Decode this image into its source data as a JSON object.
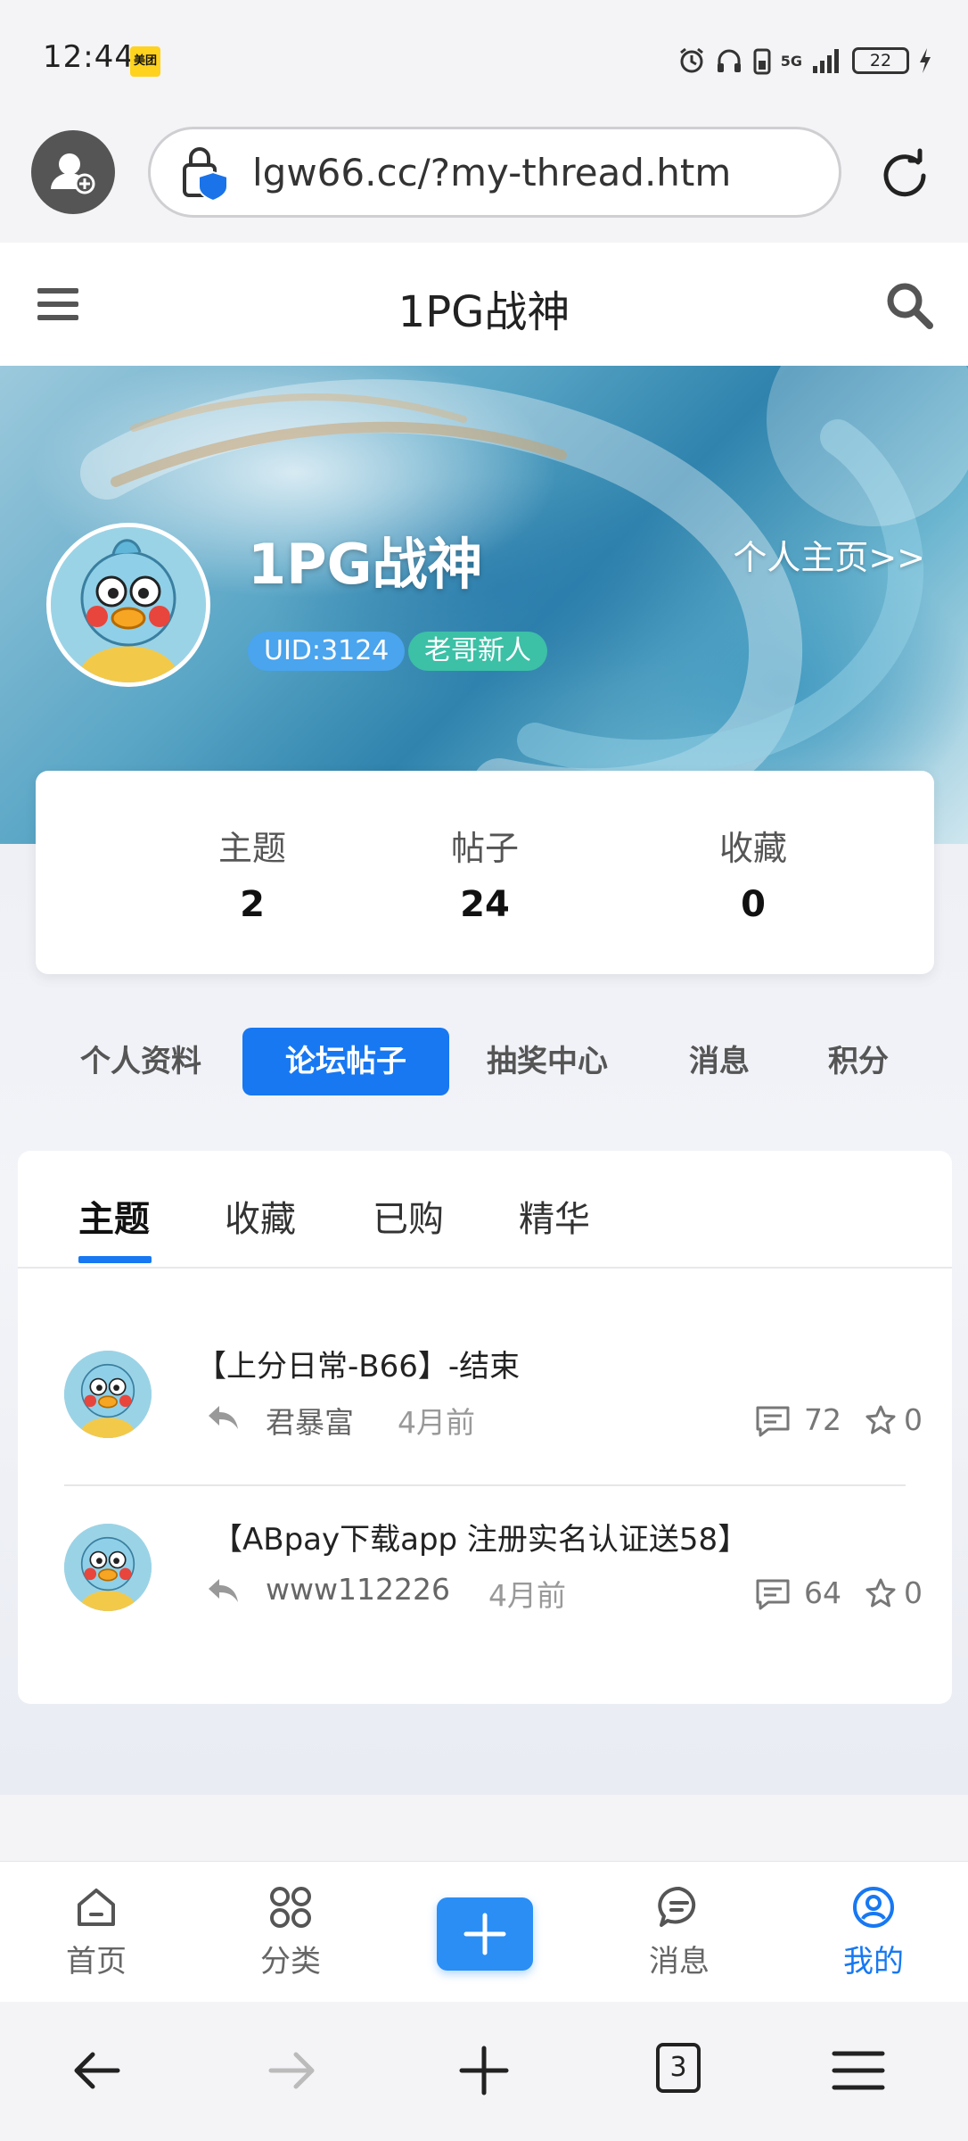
{
  "status_bar": {
    "time": "12:44",
    "app_badge": "美团",
    "network": "5G",
    "battery": "22"
  },
  "browser": {
    "url": "lgw66.cc/?my-thread.htm",
    "tab_count": "3"
  },
  "site": {
    "title": "1PG战神"
  },
  "profile": {
    "name": "1PG战神",
    "home_link": "个人主页>>",
    "uid": "UID:3124",
    "level": "老哥新人"
  },
  "stats": [
    {
      "label": "主题",
      "value": "2"
    },
    {
      "label": "帖子",
      "value": "24"
    },
    {
      "label": "收藏",
      "value": "0"
    }
  ],
  "section_tabs": [
    {
      "label": "个人资料",
      "active": false
    },
    {
      "label": "论坛帖子",
      "active": true
    },
    {
      "label": "抽奖中心",
      "active": false
    },
    {
      "label": "消息",
      "active": false
    },
    {
      "label": "积分",
      "active": false
    }
  ],
  "sub_tabs": [
    {
      "label": "主题",
      "active": true
    },
    {
      "label": "收藏",
      "active": false
    },
    {
      "label": "已购",
      "active": false
    },
    {
      "label": "精华",
      "active": false
    }
  ],
  "threads": [
    {
      "title": "【上分日常-B66】-结束",
      "author": "君暴富",
      "time": "4月前",
      "replies": "72",
      "favorites": "0"
    },
    {
      "title": "【ABpay下载app 注册实名认证送58】",
      "author": "www112226",
      "time": "4月前",
      "replies": "64",
      "favorites": "0"
    }
  ],
  "bottom_nav": [
    {
      "label": "首页",
      "icon": "home-icon",
      "active": false
    },
    {
      "label": "分类",
      "icon": "grid-icon",
      "active": false
    },
    {
      "label": "消息",
      "icon": "chat-icon",
      "active": false
    },
    {
      "label": "我的",
      "icon": "user-circle-icon",
      "active": true
    }
  ],
  "colors": {
    "accent": "#1778f2",
    "uid_badge": "#4aa4ee",
    "level_badge": "#3cc0a6"
  }
}
